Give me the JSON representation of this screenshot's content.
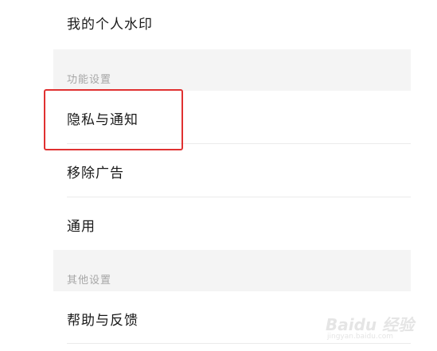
{
  "settings": {
    "items": [
      {
        "label": "我的个人水印"
      }
    ],
    "sections": [
      {
        "header": "功能设置",
        "items": [
          {
            "label": "隐私与通知"
          },
          {
            "label": "移除广告"
          },
          {
            "label": "通用"
          }
        ]
      },
      {
        "header": "其他设置",
        "items": [
          {
            "label": "帮助与反馈"
          }
        ]
      }
    ]
  },
  "watermark": {
    "main": "Baidu 经验",
    "sub": "jingyan.baidu.com"
  },
  "colors": {
    "highlight": "#e03131",
    "section_bg": "#f4f4f4",
    "text": "#1a1a1a",
    "section_text": "#a6a6a6"
  }
}
